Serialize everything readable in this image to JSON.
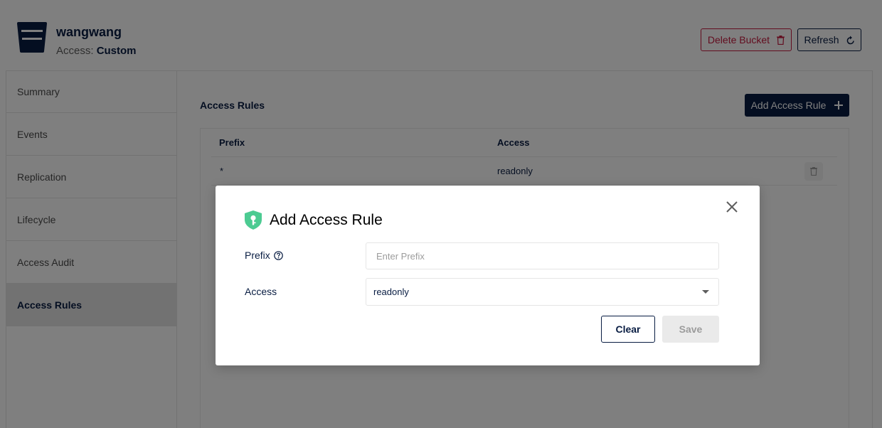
{
  "header": {
    "bucket_name": "wangwang",
    "access_label": "Access:",
    "access_value": "Custom",
    "delete_button": "Delete Bucket",
    "refresh_button": "Refresh"
  },
  "sidebar": {
    "items": [
      {
        "label": "Summary"
      },
      {
        "label": "Events"
      },
      {
        "label": "Replication"
      },
      {
        "label": "Lifecycle"
      },
      {
        "label": "Access Audit"
      },
      {
        "label": "Access Rules",
        "active": true
      }
    ]
  },
  "main": {
    "title": "Access Rules",
    "add_button": "Add Access Rule",
    "table": {
      "columns": [
        "Prefix",
        "Access"
      ],
      "rows": [
        {
          "prefix": "*",
          "access": "readonly"
        }
      ]
    }
  },
  "modal": {
    "title": "Add Access Rule",
    "prefix_label": "Prefix",
    "prefix_placeholder": "Enter Prefix",
    "prefix_value": "",
    "access_label": "Access",
    "access_selected": "readonly",
    "clear_button": "Clear",
    "save_button": "Save"
  },
  "colors": {
    "primary": "#081c42",
    "danger": "#c51b3f",
    "shield": "#4ccb92"
  },
  "icons": {
    "bucket": "bucket-icon",
    "delete": "trash-icon",
    "refresh": "refresh-icon",
    "add": "plus-icon",
    "row_delete": "trash-icon",
    "close": "close-icon",
    "modal": "shield-key-icon",
    "help": "help-icon",
    "dropdown": "chevron-down-icon"
  }
}
